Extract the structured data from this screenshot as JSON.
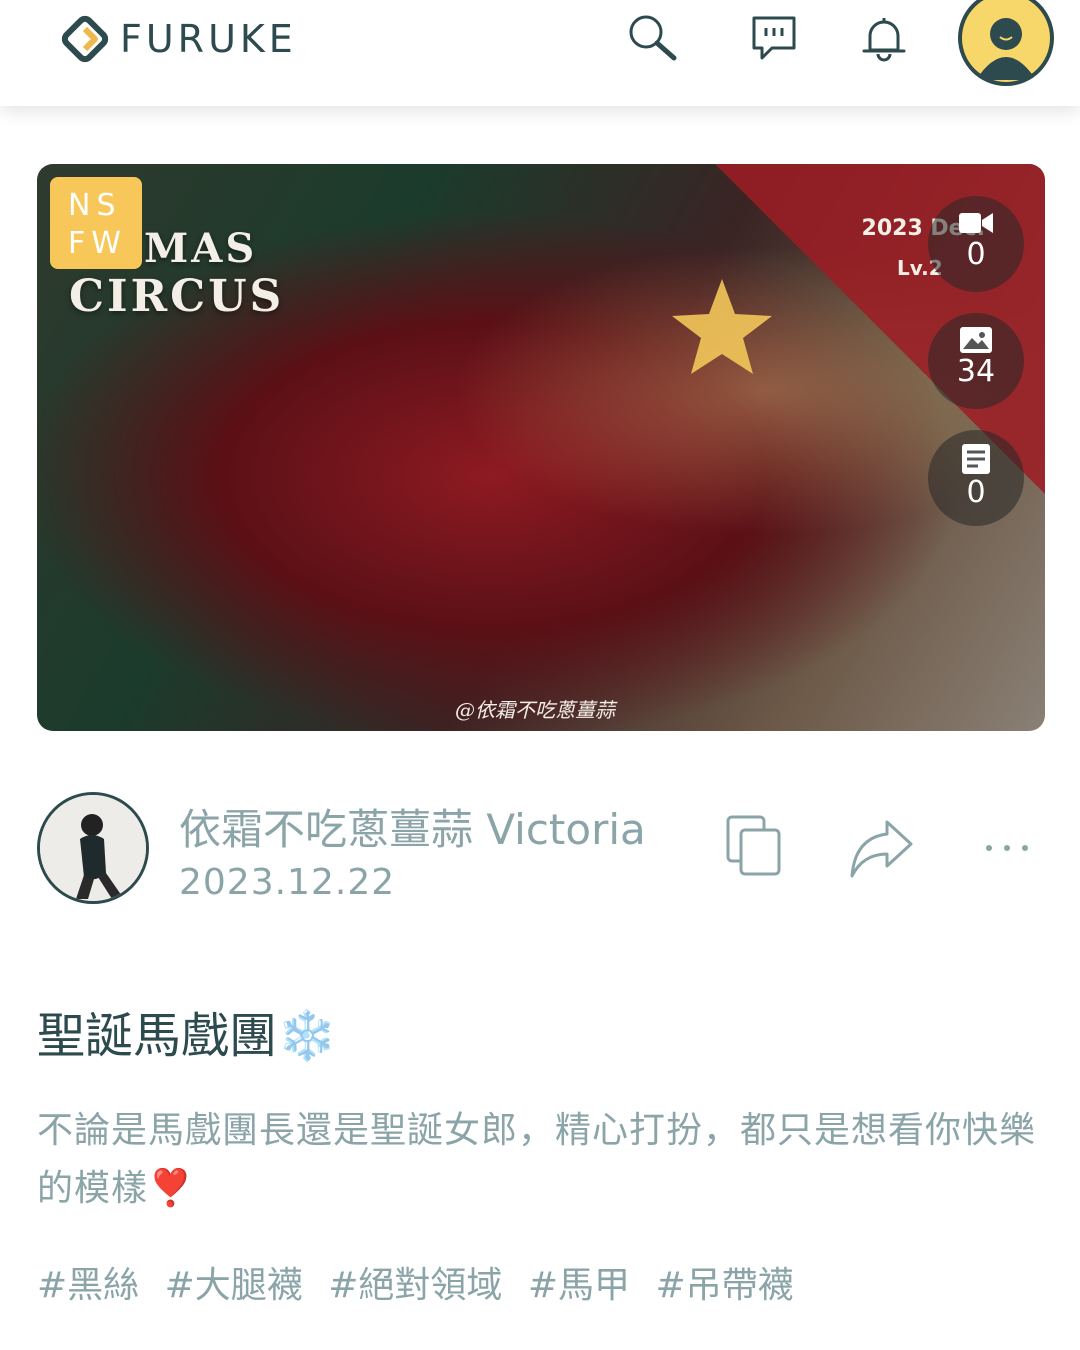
{
  "header": {
    "brand": "FURUKE",
    "icons": [
      "search-icon",
      "message-icon",
      "bell-icon",
      "user-avatar-icon"
    ],
    "accent_color": "#2d4a4e",
    "avatar_color": "#f7d76a"
  },
  "cover": {
    "badge": "NS FW",
    "badge_line1": "NS",
    "badge_line2": "FW",
    "badge_color": "#f7c75a",
    "title_line1": "MAS",
    "title_line2": "CIRCUS",
    "date_text": "2023 Dec.",
    "level_text": "Lv.2",
    "watermark": "@依霜不吃蔥薑蒜",
    "stats": {
      "videos": "0",
      "images": "34",
      "articles": "0"
    }
  },
  "author": {
    "name": "依霜不吃蔥薑蒜 Victoria",
    "date": "2023.12.22"
  },
  "actions": [
    "copy-icon",
    "share-icon",
    "more-icon"
  ],
  "post": {
    "title": "聖誕馬戲團❄️",
    "body": "不論是馬戲團長還是聖誕女郎，精心打扮，都只是想看你快樂的模樣❣️",
    "tags": [
      "#黑絲",
      "#大腿襪",
      "#絕對領域",
      "#馬甲",
      "#吊帶襪"
    ]
  }
}
